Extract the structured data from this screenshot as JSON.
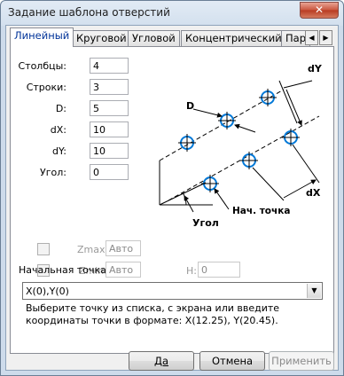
{
  "window": {
    "title": "Задание шаблона отверстий",
    "close_glyph": "✕"
  },
  "tabs": [
    {
      "label": "Линейный",
      "active": true
    },
    {
      "label": "Круговой"
    },
    {
      "label": "Угловой"
    },
    {
      "label": "Концентрический"
    },
    {
      "label": "Пар"
    }
  ],
  "fields": [
    {
      "label": "Столбцы:",
      "value": "4"
    },
    {
      "label": "Строки:",
      "value": "3"
    },
    {
      "label": "D:",
      "value": "5"
    },
    {
      "label": "dX:",
      "value": "10"
    },
    {
      "label": "dY:",
      "value": "10"
    },
    {
      "label": "Угол:",
      "value": "0"
    }
  ],
  "diagram": {
    "label_d": "D",
    "label_dy": "dY",
    "label_dx": "dX",
    "label_start": "Нач. точка",
    "label_angle": "Угол"
  },
  "zmax": {
    "label": "Zmax:",
    "value": "Авто",
    "checked": false
  },
  "zmin": {
    "label": "Zmin:",
    "value": "Авто",
    "checked": false
  },
  "h": {
    "label": "H:",
    "value": "0"
  },
  "start_point": {
    "section_label": "Начальная точка",
    "value": "X(0),Y(0)",
    "hint": "Выберите точку из списка, с экрана или введите координаты точки в формате: X(12.25), Y(20.45)."
  },
  "buttons": {
    "ok": "Да",
    "cancel": "Отмена",
    "apply": "Применить"
  },
  "colors": {
    "hole": "#0078d7",
    "close": "#c7402a"
  },
  "icons": {
    "close": "close-icon",
    "dropdown": "chevron-down-icon"
  }
}
